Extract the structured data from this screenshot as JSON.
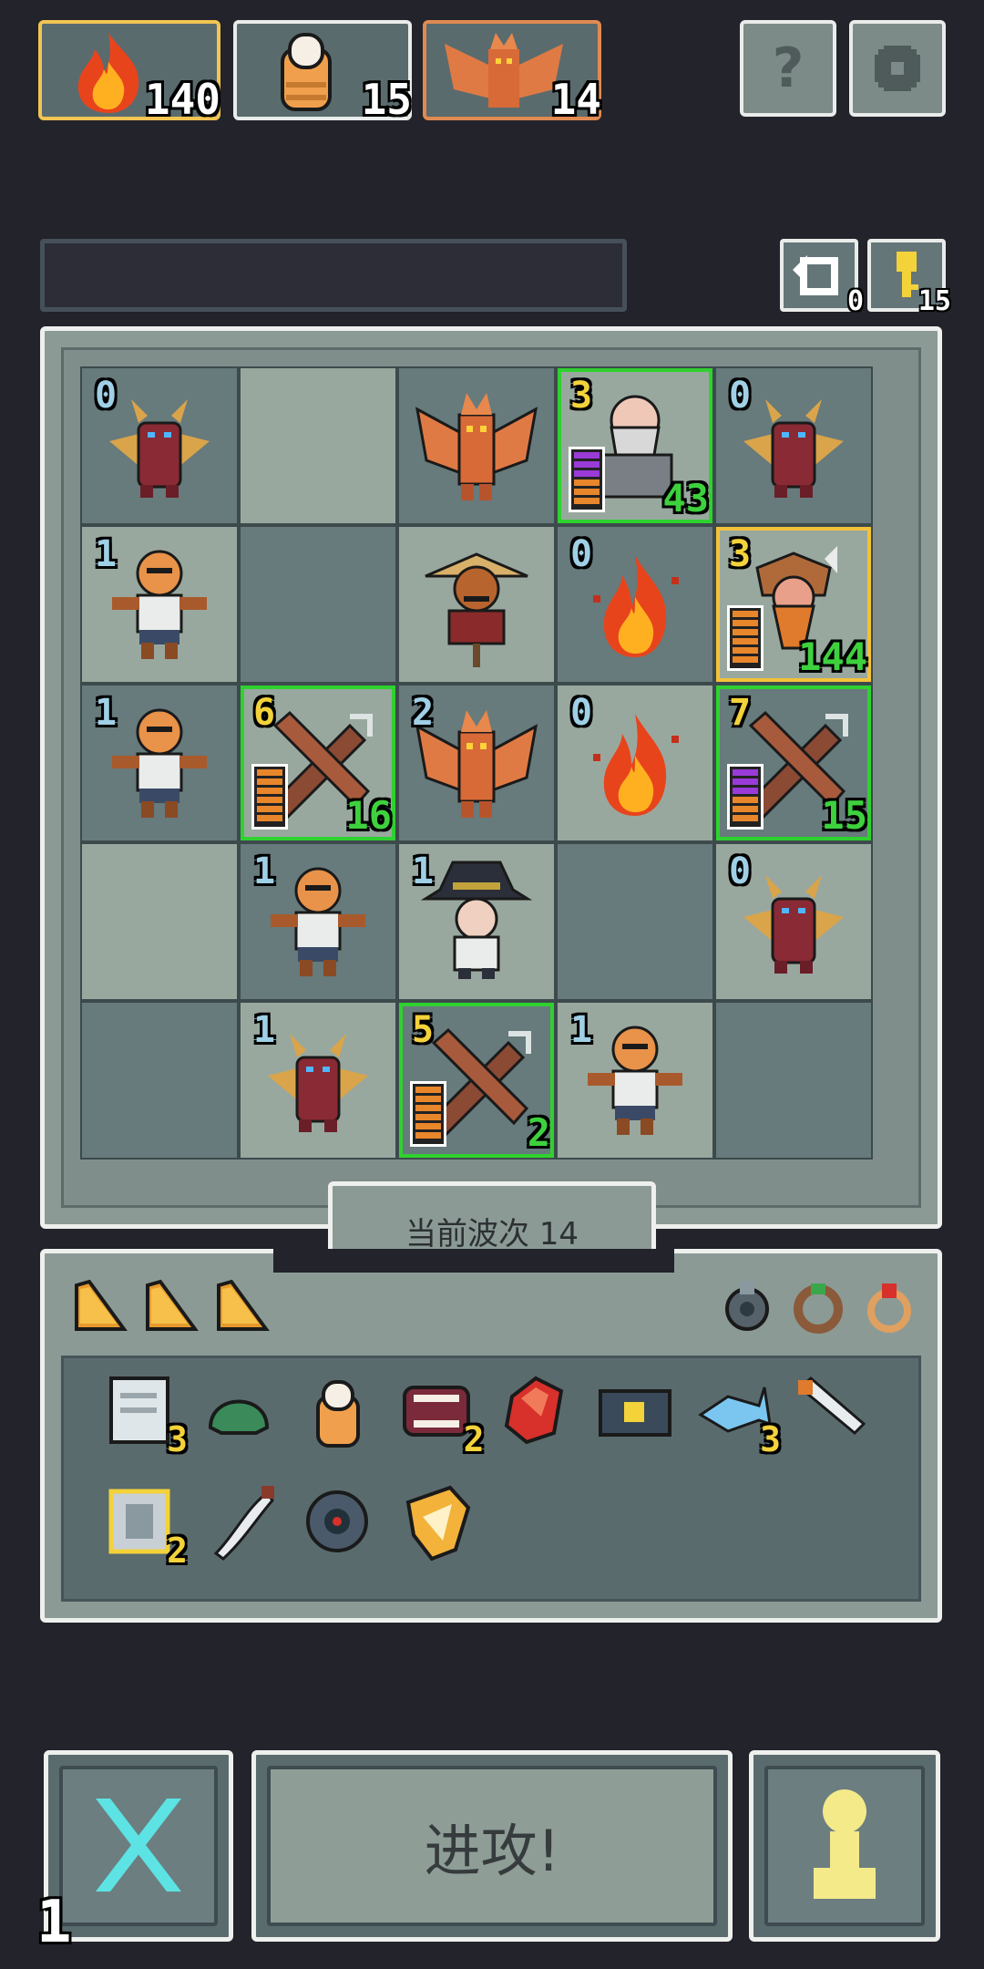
{
  "resources": [
    {
      "icon": "fire-icon",
      "count": "140"
    },
    {
      "icon": "finger-icon",
      "count": "15"
    },
    {
      "icon": "winged-demon-icon",
      "count": "14"
    }
  ],
  "top_buttons": {
    "help_label": "?",
    "settings_icon": "gear-icon"
  },
  "undo": {
    "count": "0"
  },
  "keys": {
    "count": "15"
  },
  "board": {
    "rows": [
      [
        {
          "unit": "horned-demon",
          "level": "0"
        },
        {
          "unit": ""
        },
        {
          "unit": "winged-demon"
        },
        {
          "unit": "old-wizard",
          "level": "3",
          "hp": "43",
          "gauge": "purple"
        },
        {
          "unit": "horned-demon",
          "level": "0"
        }
      ],
      [
        {
          "unit": "bald-brute",
          "level": "1"
        },
        {
          "unit": ""
        },
        {
          "unit": "scarecrow"
        },
        {
          "unit": "fire",
          "level": "0"
        },
        {
          "unit": "viking",
          "level": "3",
          "hp": "144",
          "gauge": "orange"
        }
      ],
      [
        {
          "unit": "bald-brute",
          "level": "1"
        },
        {
          "unit": "crossed-swords",
          "level": "6",
          "hp": "16",
          "gauge": "orange"
        },
        {
          "unit": "winged-demon",
          "level": "2"
        },
        {
          "unit": "fire",
          "level": "0"
        },
        {
          "unit": "crossed-swords",
          "level": "7",
          "hp": "15",
          "gauge": "purple"
        }
      ],
      [
        {
          "unit": ""
        },
        {
          "unit": "bald-brute",
          "level": "1"
        },
        {
          "unit": "wizard-kid",
          "level": "1"
        },
        {
          "unit": ""
        },
        {
          "unit": "horned-demon",
          "level": "0"
        }
      ],
      [
        {
          "unit": ""
        },
        {
          "unit": "horned-demon",
          "level": "1"
        },
        {
          "unit": "crossed-swords",
          "level": "5",
          "hp": "2",
          "gauge": "orange"
        },
        {
          "unit": "bald-brute",
          "level": "1"
        },
        {
          "unit": ""
        }
      ]
    ]
  },
  "wave": {
    "label": "当前波次 14"
  },
  "inventory": {
    "charges": 3,
    "accessories": [
      "amulet-icon",
      "green-ring-icon",
      "red-ring-icon"
    ],
    "items": [
      {
        "icon": "scroll-icon",
        "count": "3"
      },
      {
        "icon": "green-helmet-icon",
        "count": ""
      },
      {
        "icon": "finger-icon",
        "count": ""
      },
      {
        "icon": "fanged-mouth-icon",
        "count": "2"
      },
      {
        "icon": "ruby-icon",
        "count": ""
      },
      {
        "icon": "camera-icon",
        "count": ""
      },
      {
        "icon": "blue-fish-icon",
        "count": "3"
      },
      {
        "icon": "dagger-icon",
        "count": ""
      },
      {
        "icon": "silver-block-icon",
        "count": "2"
      },
      {
        "icon": "curved-blade-icon",
        "count": ""
      },
      {
        "icon": "eye-disc-icon",
        "count": ""
      },
      {
        "icon": "gold-shield-icon",
        "count": ""
      }
    ]
  },
  "bottom": {
    "cancel_icon": "cross-icon",
    "attack_label": "进攻!",
    "pawn_icon": "pawn-icon",
    "speed": "1"
  }
}
